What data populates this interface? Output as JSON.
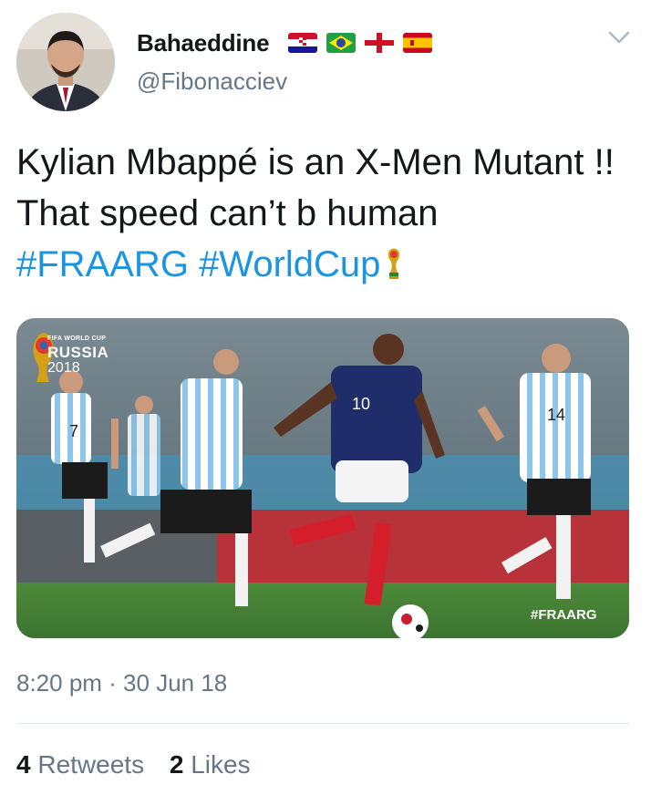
{
  "tweet": {
    "display_name": "Bahaeddine",
    "handle": "@Fibonacciev",
    "flags": [
      "croatia-flag",
      "brazil-flag",
      "england-flag",
      "spain-flag"
    ],
    "text_before": "Kylian Mbappé is an X-Men Mutant !! That speed can’t b human ",
    "hashtags": [
      "#FRAARG",
      "#WorldCup"
    ],
    "emoji": "world-cup-trophy-icon",
    "timestamp": "8:20 pm · 30 Jun 18"
  },
  "media": {
    "logo_small": "FIFA WORLD CUP",
    "logo_title": "RUSSIA",
    "logo_year": "2018",
    "corner_hashtag": "#FRAARG",
    "jersey_numbers": [
      "7",
      "10",
      "14"
    ]
  },
  "stats": {
    "retweets_count": "4",
    "retweets_label": "Retweets",
    "likes_count": "2",
    "likes_label": "Likes"
  },
  "colors": {
    "hashtag": "#1b95e0",
    "muted": "#657786",
    "text": "#14171a",
    "divider": "#e1e8ed"
  }
}
